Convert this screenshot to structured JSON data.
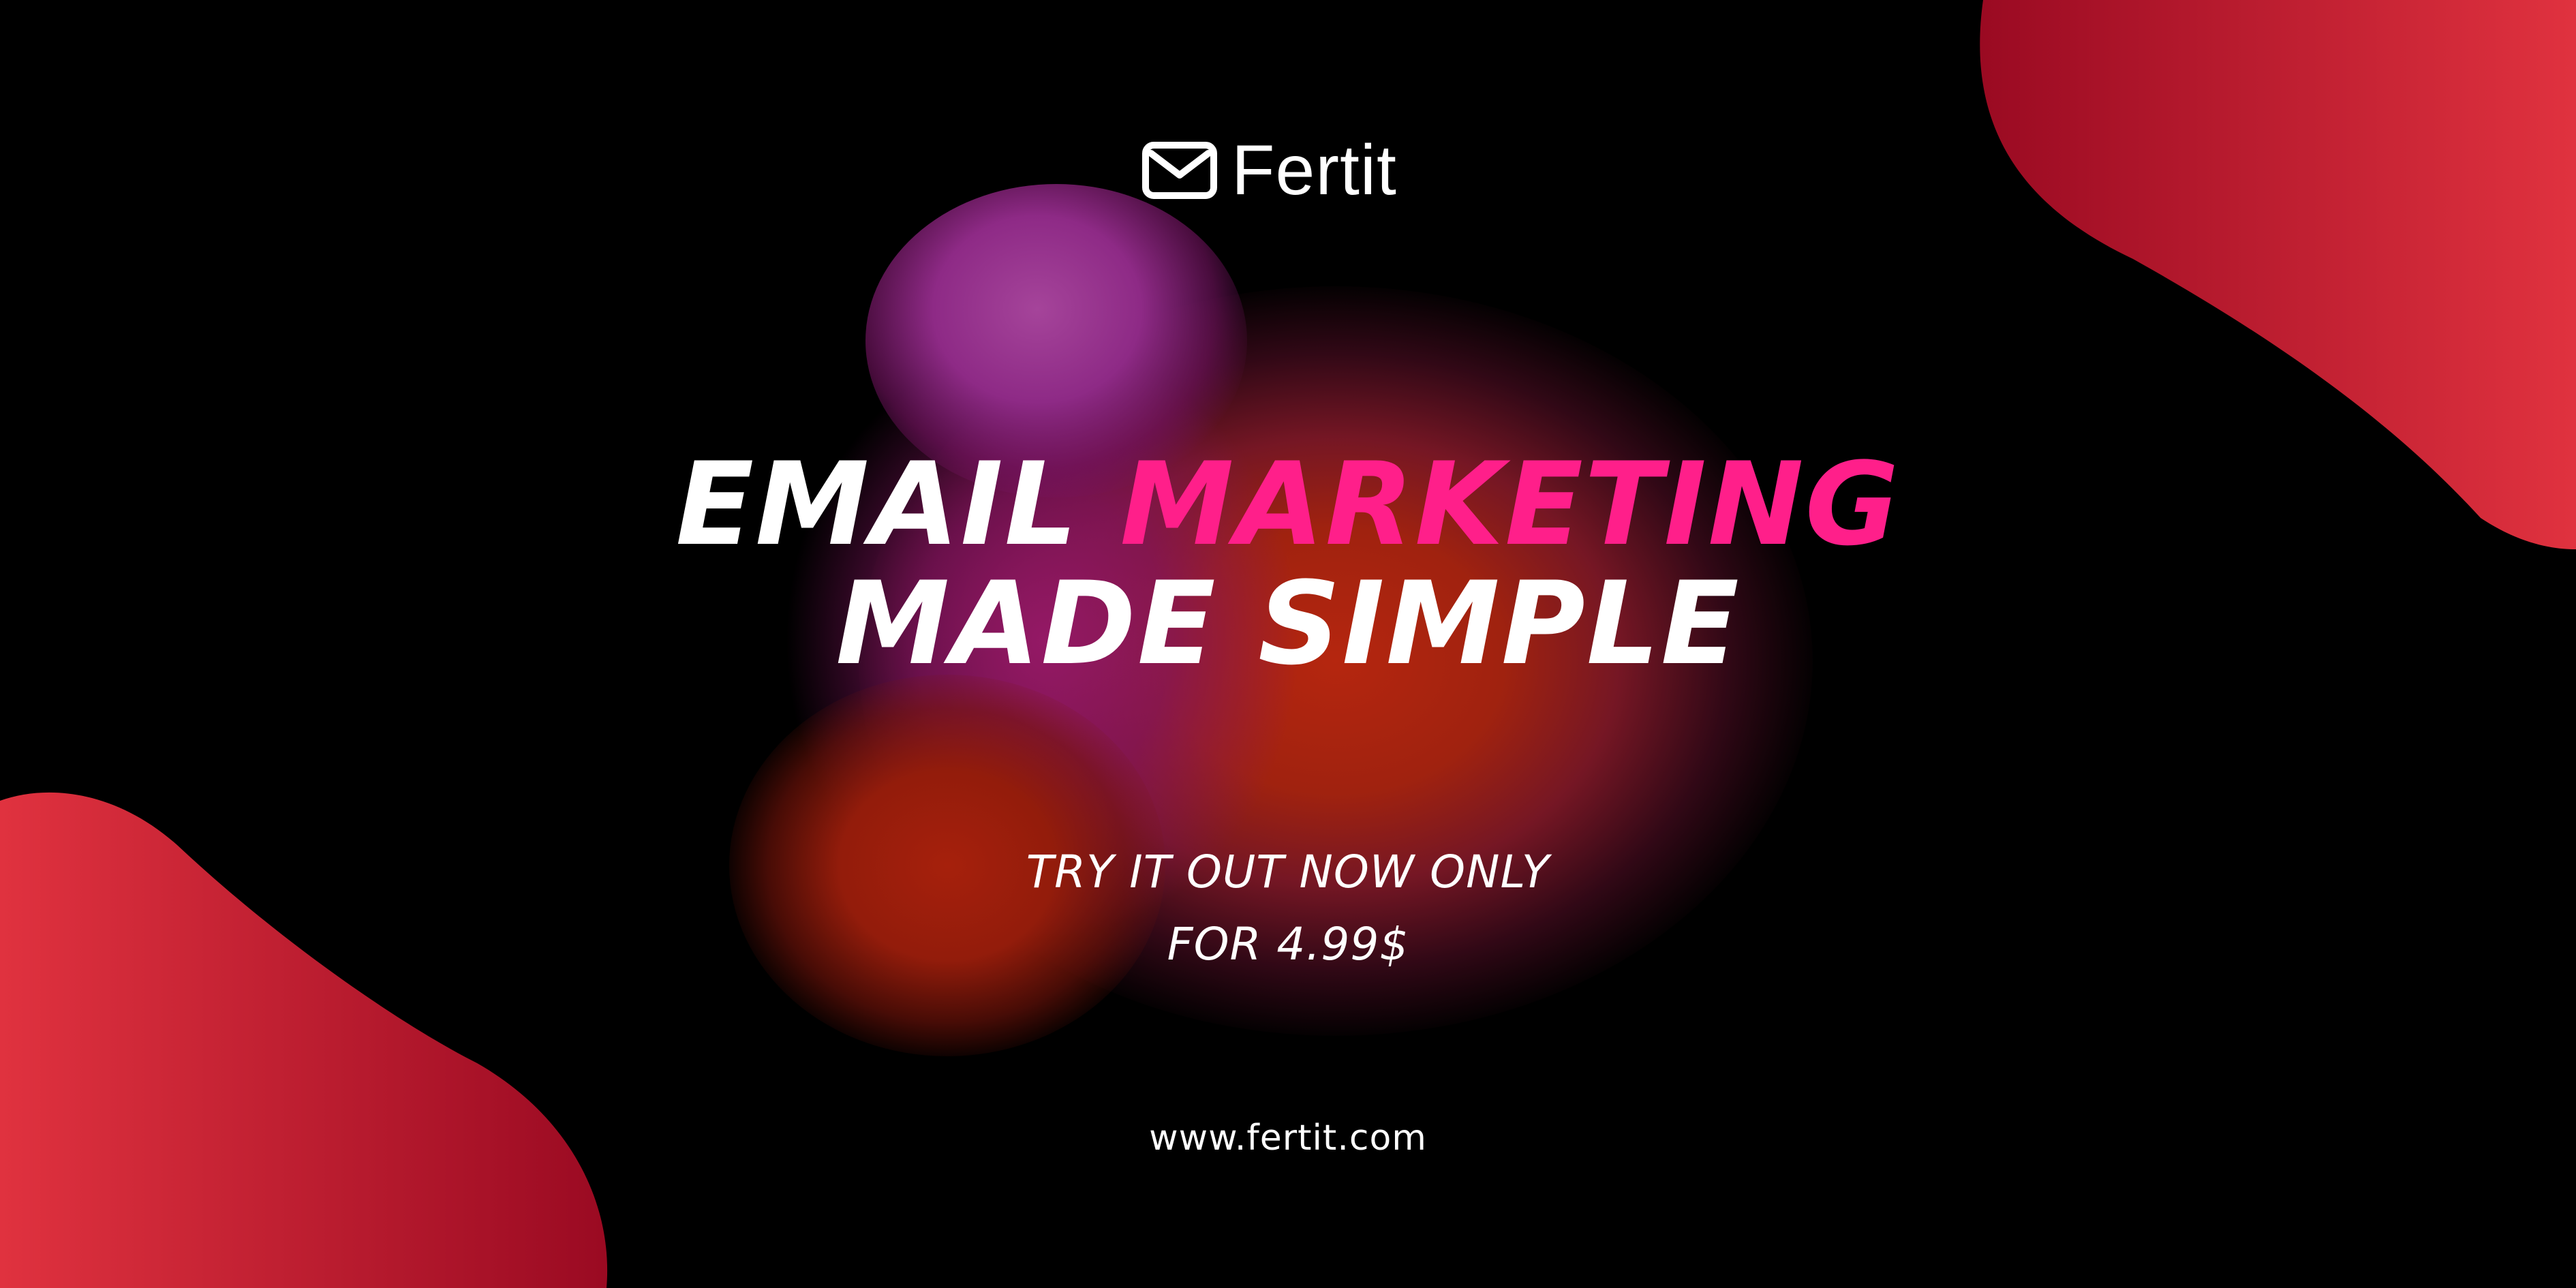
{
  "brand": {
    "name": "Fertit",
    "logo_icon": "envelope-icon"
  },
  "headline": {
    "line1_white": "EMAIL",
    "line1_accent": "MARKETING",
    "line2": "MADE SIMPLE"
  },
  "offer": {
    "line1": "TRY IT OUT NOW ONLY",
    "line2": "FOR 4.99$"
  },
  "website": "www.fertit.com",
  "colors": {
    "background": "#000000",
    "accent_pink": "#ff1f8a",
    "blob_red_light": "#e0323f",
    "blob_red_dark": "#9a0a22",
    "glow_purple": "#a5449a",
    "glow_orange": "#b5260f",
    "text": "#ffffff"
  }
}
